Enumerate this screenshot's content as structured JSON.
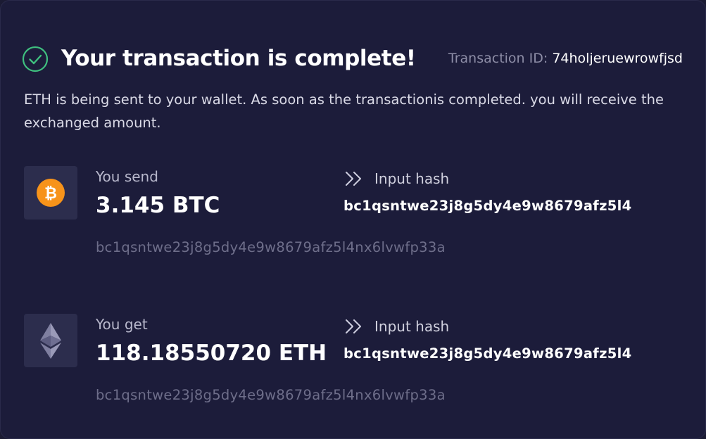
{
  "header": {
    "title": "Your transaction is complete!",
    "transaction_id_label": "Transaction ID:",
    "transaction_id_value": "74holjeruewrowfjsd",
    "icon": "check-circle-icon"
  },
  "description": "ETH is being sent to your wallet. As soon as the transactionis completed. you will receive the exchanged amount.",
  "send": {
    "label": "You send",
    "amount": "3.145 BTC",
    "coin_icon": "bitcoin-icon",
    "address": "bc1qsntwe23j8g5dy4e9w8679afz5l4nx6lvwfp33a",
    "hash_label": "Input hash",
    "hash_value": "bc1qsntwe23j8g5dy4e9w8679afz5l4"
  },
  "get": {
    "label": "You get",
    "amount": "118.18550720 ETH",
    "coin_icon": "ethereum-icon",
    "address": "bc1qsntwe23j8g5dy4e9w8679afz5l4nx6lvwfp33a",
    "hash_label": "Input hash",
    "hash_value": "bc1qsntwe23j8g5dy4e9w8679afz5l4"
  },
  "colors": {
    "background": "#1c1c3a",
    "success": "#3fbf7f",
    "bitcoin": "#f7931a",
    "muted_text": "#8d8da6",
    "address_text": "#6e6e8a"
  }
}
